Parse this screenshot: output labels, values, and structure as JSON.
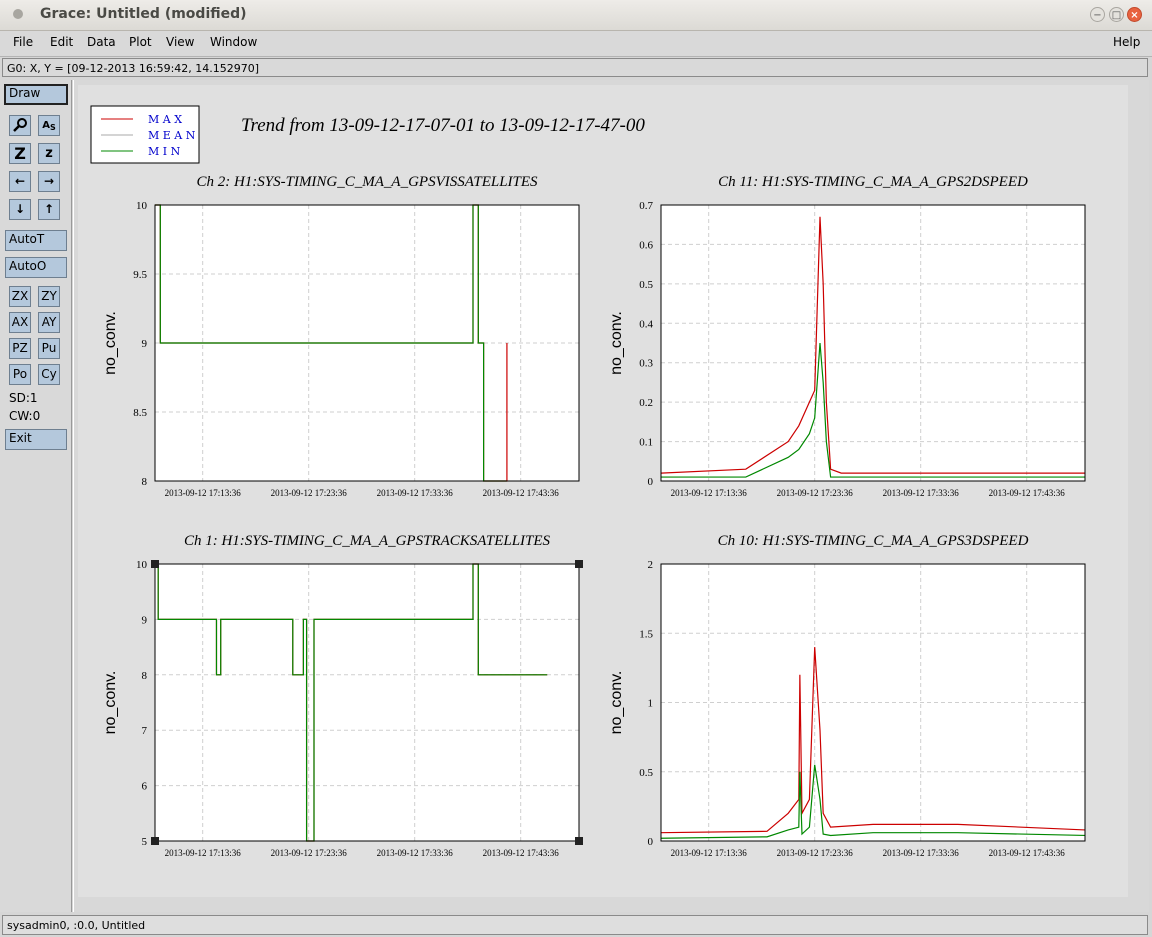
{
  "window": {
    "title": "Grace: Untitled (modified)"
  },
  "menu": {
    "file": "File",
    "edit": "Edit",
    "data": "Data",
    "plot": "Plot",
    "view": "View",
    "window": "Window",
    "help": "Help"
  },
  "locator": "G0: X, Y = [09-12-2013 16:59:42, 14.152970]",
  "toolbar": {
    "draw": "Draw",
    "autot": "AutoT",
    "autoo": "AutoO",
    "zx": "ZX",
    "zy": "ZY",
    "ax": "AX",
    "ay": "AY",
    "pz": "PZ",
    "pu": "Pu",
    "po": "Po",
    "cy": "Cy",
    "sd": "SD:1",
    "cw": "CW:0",
    "exit": "Exit"
  },
  "status": "sysadmin0, :0.0, Untitled",
  "plot": {
    "title": "Trend from 13-09-12-17-07-01 to 13-09-12-17-47-00",
    "legend": [
      {
        "label": "M A X",
        "color": "#cc0000"
      },
      {
        "label": "M E A N",
        "color": "#bbbbbb"
      },
      {
        "label": "M I N",
        "color": "#008800"
      }
    ],
    "colors": {
      "max": "#cc0000",
      "mean": "#aaaaaa",
      "min": "#008800"
    }
  },
  "chart_data": [
    {
      "type": "line",
      "title": "Ch 2: H1:SYS-TIMING_C_MA_A_GPSVISSATELLITES",
      "ylabel": "no_conv.",
      "ylim": [
        8,
        10
      ],
      "yticks": [
        "10",
        "9.5",
        "9",
        "8.5",
        "8"
      ],
      "xticks": [
        "2013-09-12 17:13:36",
        "2013-09-12 17:23:36",
        "2013-09-12 17:33:36",
        "2013-09-12 17:43:36"
      ],
      "series": [
        {
          "name": "MAX",
          "x": [
            0,
            0.5,
            0.5,
            30,
            30,
            30.5,
            30.5,
            31,
            31,
            33.2,
            33.2
          ],
          "y": [
            10,
            10,
            9,
            9,
            10,
            10,
            9,
            9,
            8,
            8,
            9
          ]
        },
        {
          "name": "MIN",
          "x": [
            0,
            0.5,
            0.5,
            30,
            30,
            30.5,
            30.5,
            31,
            31,
            33.2
          ],
          "y": [
            10,
            10,
            9,
            9,
            10,
            10,
            9,
            9,
            8,
            8
          ]
        }
      ]
    },
    {
      "type": "line",
      "title": "Ch 11: H1:SYS-TIMING_C_MA_A_GPS2DSPEED",
      "ylabel": "no_conv.",
      "ylim": [
        0,
        0.7
      ],
      "yticks": [
        "0.7",
        "0.6",
        "0.5",
        "0.4",
        "0.3",
        "0.2",
        "0.1",
        "0"
      ],
      "xticks": [
        "2013-09-12 17:13:36",
        "2013-09-12 17:23:36",
        "2013-09-12 17:33:36",
        "2013-09-12 17:43:36"
      ],
      "series": [
        {
          "name": "MAX",
          "x": [
            0,
            8,
            12,
            13,
            14,
            14.5,
            15,
            15.3,
            15.6,
            16,
            17,
            20,
            30,
            40
          ],
          "y": [
            0.02,
            0.03,
            0.1,
            0.14,
            0.2,
            0.23,
            0.67,
            0.5,
            0.2,
            0.03,
            0.02,
            0.02,
            0.02,
            0.02
          ]
        },
        {
          "name": "MIN",
          "x": [
            0,
            8,
            12,
            13,
            14,
            14.5,
            15,
            15.3,
            15.6,
            16,
            17,
            20,
            30,
            40
          ],
          "y": [
            0.01,
            0.01,
            0.06,
            0.08,
            0.12,
            0.16,
            0.35,
            0.25,
            0.1,
            0.01,
            0.01,
            0.01,
            0.01,
            0.01
          ]
        }
      ]
    },
    {
      "type": "line",
      "title": "Ch 1: H1:SYS-TIMING_C_MA_A_GPSTRACKSATELLITES",
      "ylabel": "no_conv.",
      "ylim": [
        5,
        10
      ],
      "yticks": [
        "10",
        "9",
        "8",
        "7",
        "6",
        "5"
      ],
      "xticks": [
        "2013-09-12 17:13:36",
        "2013-09-12 17:23:36",
        "2013-09-12 17:33:36",
        "2013-09-12 17:43:36"
      ],
      "series": [
        {
          "name": "MAX",
          "x": [
            0,
            0.3,
            0.3,
            5.8,
            5.8,
            6.2,
            6.2,
            13,
            13,
            14,
            14,
            14.3,
            14.3,
            15,
            15,
            30,
            30,
            30.5,
            30.5,
            31,
            31,
            37
          ],
          "y": [
            10,
            10,
            9,
            9,
            8,
            8,
            9,
            9,
            8,
            8,
            9,
            9,
            5,
            5,
            9,
            9,
            10,
            10,
            8,
            8,
            8,
            8
          ]
        },
        {
          "name": "MIN",
          "x": [
            0,
            0.3,
            0.3,
            5.8,
            5.8,
            6.2,
            6.2,
            13,
            13,
            14,
            14,
            14.3,
            14.3,
            15,
            15,
            30,
            30,
            30.5,
            30.5,
            31,
            31,
            37
          ],
          "y": [
            10,
            10,
            9,
            9,
            8,
            8,
            9,
            9,
            8,
            8,
            9,
            9,
            5,
            5,
            9,
            9,
            10,
            10,
            8,
            8,
            8,
            8
          ]
        }
      ]
    },
    {
      "type": "line",
      "title": "Ch 10: H1:SYS-TIMING_C_MA_A_GPS3DSPEED",
      "ylabel": "no_conv.",
      "ylim": [
        0,
        2
      ],
      "yticks": [
        "2",
        "1.5",
        "1",
        "0.5",
        "0"
      ],
      "xticks": [
        "2013-09-12 17:13:36",
        "2013-09-12 17:23:36",
        "2013-09-12 17:33:36",
        "2013-09-12 17:43:36"
      ],
      "series": [
        {
          "name": "MAX",
          "x": [
            0,
            10,
            12,
            13,
            13.1,
            13.3,
            14,
            14.5,
            15,
            15.3,
            16,
            20,
            28,
            40
          ],
          "y": [
            0.06,
            0.07,
            0.2,
            0.3,
            1.2,
            0.2,
            0.3,
            1.4,
            0.8,
            0.2,
            0.1,
            0.12,
            0.12,
            0.08
          ]
        },
        {
          "name": "MIN",
          "x": [
            0,
            10,
            12,
            13,
            13.1,
            13.3,
            14,
            14.5,
            15,
            15.3,
            16,
            20,
            28,
            40
          ],
          "y": [
            0.02,
            0.03,
            0.08,
            0.1,
            0.5,
            0.05,
            0.1,
            0.55,
            0.3,
            0.05,
            0.04,
            0.06,
            0.06,
            0.04
          ]
        }
      ]
    }
  ]
}
